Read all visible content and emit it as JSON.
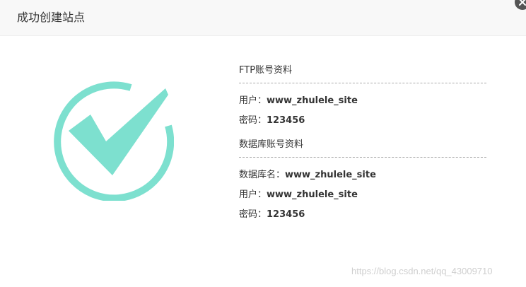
{
  "dialog": {
    "title": "成功创建站点",
    "close_icon": "close-icon",
    "success_icon": "checkmark-circle-icon",
    "accent_color": "#7de0cf"
  },
  "ftp": {
    "heading": "FTP账号资料",
    "user_label": "用户：",
    "user_value": "www_zhulele_site",
    "password_label": "密码：",
    "password_value": "123456"
  },
  "database": {
    "heading": "数据库账号资料",
    "name_label": "数据库名：",
    "name_value": "www_zhulele_site",
    "user_label": "用户：",
    "user_value": "www_zhulele_site",
    "password_label": "密码：",
    "password_value": "123456"
  },
  "watermark": "https://blog.csdn.net/qq_43009710"
}
